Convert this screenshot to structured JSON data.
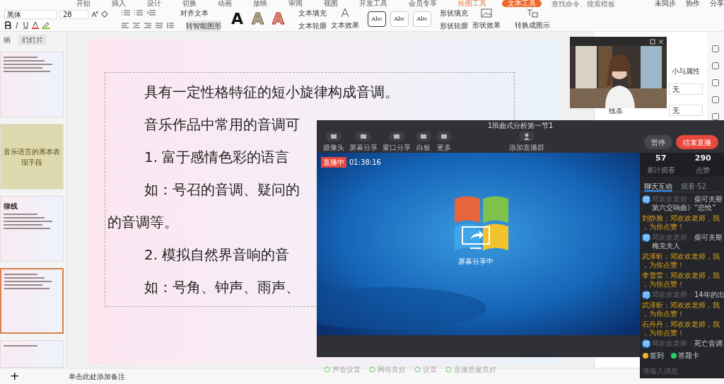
{
  "menu_tabs": [
    {
      "label": "开始",
      "selected": false
    },
    {
      "label": "插入",
      "selected": false
    },
    {
      "label": "设计",
      "selected": false
    },
    {
      "label": "切换",
      "selected": false
    },
    {
      "label": "动画",
      "selected": false
    },
    {
      "label": "放映",
      "selected": false
    },
    {
      "label": "审阅",
      "selected": false
    },
    {
      "label": "视图",
      "selected": false
    },
    {
      "label": "开发工具",
      "selected": false
    },
    {
      "label": "会员专享",
      "selected": false
    },
    {
      "label": "绘图工具",
      "selected": false
    },
    {
      "label": "文本工具",
      "selected": true
    }
  ],
  "search": {
    "placeholder": "查找命令、搜索模板"
  },
  "header_actions": [
    "未同步",
    "协作",
    "分享"
  ],
  "ribbon": {
    "font": "黑体",
    "size": "28",
    "align_text": "对齐文本",
    "smart_art": "转智能图形",
    "text_fill": "文本填充",
    "text_outline": "文本轮廓",
    "text_effect": "文本效果",
    "text_samples": [
      "A",
      "A",
      "A"
    ],
    "style_samples": [
      "Abc",
      "Abc",
      "Abc"
    ],
    "shape_fill": "形状填充",
    "shape_outline": "形状轮廓",
    "shape_effect": "形状效果",
    "convert": "转换成图示"
  },
  "panel_tabs": [
    {
      "label": "纲",
      "selected": false
    },
    {
      "label": "幻灯片",
      "selected": true
    }
  ],
  "slides": [
    {
      "kind": "text",
      "selected": false
    },
    {
      "kind": "section",
      "title": "音乐语言的基本表现手段",
      "selected": false
    },
    {
      "kind": "text",
      "title": "律线",
      "selected": false
    },
    {
      "kind": "text",
      "selected": true
    },
    {
      "kind": "text",
      "selected": false
    }
  ],
  "slide": {
    "lines": [
      {
        "kind": "indent",
        "text": "具有一定性格特征的短小旋律构成音调。"
      },
      {
        "kind": "indent",
        "text": "音乐作品中常用的音调可"
      },
      {
        "kind": "indent",
        "text": "1.  富于感情色彩的语言"
      },
      {
        "kind": "indent",
        "text": "如：号召的音调、疑问的"
      },
      {
        "kind": "flush",
        "text": "的音调等。"
      },
      {
        "kind": "indent",
        "text": "2.  模拟自然界音响的音"
      },
      {
        "kind": "indent",
        "text": "如：号角、钟声、雨声、"
      }
    ]
  },
  "notes_placeholder": "单击此处添加备注",
  "add_slide": "+",
  "props_panel": {
    "size_label": "小与属性",
    "options": [
      "无",
      "无"
    ],
    "line_label": "线条"
  },
  "live": {
    "title": "1班曲式分析第一节1",
    "tools": [
      "摄像头",
      "屏幕分享",
      "窗口分享",
      "白板",
      "更多"
    ],
    "add_group": "添加直播群",
    "pause": "暂停",
    "end": "结束直播",
    "status": "直播中",
    "time": "01:38:16",
    "sharing": "屏幕分享中",
    "footer": [
      "声音设置",
      "网络良好",
      "设置",
      "直播质量良好"
    ],
    "stats": [
      {
        "value": "57",
        "label": "累计观看"
      },
      {
        "value": "290",
        "label": "点赞"
      }
    ],
    "chat_tabs": [
      {
        "label": "聊天互动",
        "selected": true
      },
      {
        "label": "观看·52",
        "selected": false
      }
    ],
    "messages": [
      {
        "kind": "teacher",
        "avatar": "邓",
        "sender": "邓欢欢老师：",
        "text": "柴可夫斯",
        "more": "第六交响曲》“悲怆”"
      },
      {
        "kind": "student",
        "sender": "刘静雅：",
        "text": "邓欢欢老师，我",
        "more": "，为你点赞！"
      },
      {
        "kind": "teacher",
        "avatar": "邓",
        "sender": "邓欢欢老师：",
        "text": "柴可夫斯",
        "more": "梅克夫人"
      },
      {
        "kind": "student",
        "sender": "武泽昕：",
        "text": "邓欢欢老师，我",
        "more": "，为你点赞！"
      },
      {
        "kind": "student",
        "sender": "李雪雷：",
        "text": "邓欢欢老师，我",
        "more": "，为你点赞！"
      },
      {
        "kind": "teacher",
        "avatar": "邓",
        "sender": "邓欢欢老师：",
        "text": "14年的出"
      },
      {
        "kind": "student",
        "sender": "武泽昕：",
        "text": "邓欢欢老师，我",
        "more": "，为你点赞！"
      },
      {
        "kind": "student",
        "sender": "石丹丹：",
        "text": "邓欢欢老师，我",
        "more": "，为你点赞！"
      },
      {
        "kind": "teacher",
        "avatar": "邓",
        "sender": "邓欢欢老师：",
        "text": "死亡音调"
      }
    ],
    "quick": [
      {
        "label": "签到",
        "color": "#f5b324"
      },
      {
        "label": "答题卡",
        "color": "#2ecc71"
      }
    ],
    "input_placeholder": "请输入消息"
  }
}
